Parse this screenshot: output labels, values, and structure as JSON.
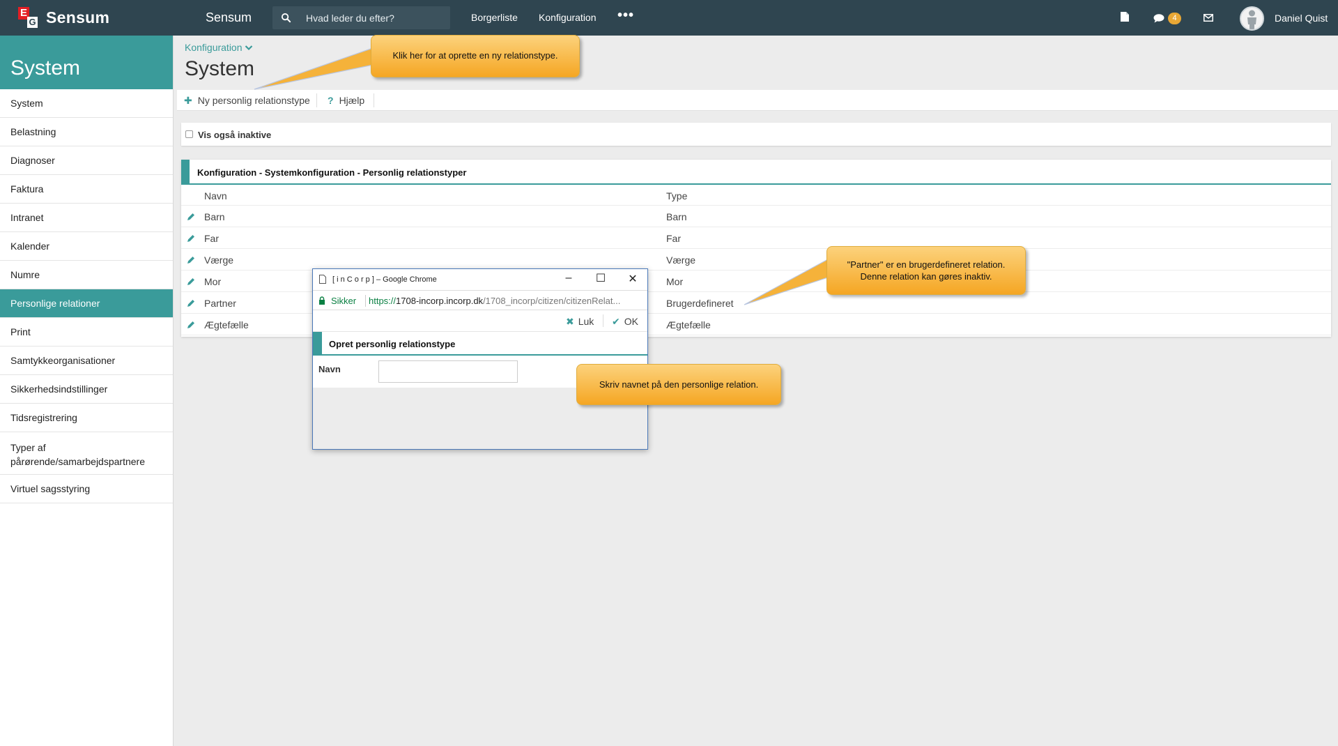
{
  "topbar": {
    "logo_e": "E",
    "logo_g": "G",
    "brand": "Sensum",
    "app_name": "Sensum",
    "search_placeholder": "Hvad leder du efter?",
    "nav": [
      "Borgerliste",
      "Konfiguration"
    ],
    "more": "•••",
    "messages_count": "4",
    "user_name": "Daniel Quist"
  },
  "sidebar": {
    "title": "System",
    "items": [
      {
        "label": "System"
      },
      {
        "label": "Belastning"
      },
      {
        "label": "Diagnoser"
      },
      {
        "label": "Faktura"
      },
      {
        "label": "Intranet"
      },
      {
        "label": "Kalender"
      },
      {
        "label": "Numre"
      },
      {
        "label": "Personlige relationer",
        "active": true
      },
      {
        "label": "Print"
      },
      {
        "label": "Samtykkeorganisationer"
      },
      {
        "label": "Sikkerhedsindstillinger"
      },
      {
        "label": "Tidsregistrering"
      },
      {
        "label": "Typer af pårørende/samarbejdspartnere"
      },
      {
        "label": "Virtuel sagsstyring"
      }
    ]
  },
  "header": {
    "breadcrumb": "Konfiguration",
    "title": "System"
  },
  "toolbar": {
    "new_label": "Ny personlig relationstype",
    "help_label": "Hjælp"
  },
  "filter": {
    "show_inactive_label": "Vis også inaktive",
    "checked": false
  },
  "table": {
    "title": "Konfiguration - Systemkonfiguration - Personlig relationstyper",
    "columns": [
      "Navn",
      "Type"
    ],
    "rows": [
      {
        "navn": "Barn",
        "type": "Barn"
      },
      {
        "navn": "Far",
        "type": "Far"
      },
      {
        "navn": "Værge",
        "type": "Værge"
      },
      {
        "navn": "Mor",
        "type": "Mor"
      },
      {
        "navn": "Partner",
        "type": "Brugerdefineret"
      },
      {
        "navn": "Ægtefælle",
        "type": "Ægtefælle"
      }
    ]
  },
  "popup": {
    "window_title": "[ i n C o r p ] – Google Chrome",
    "secure_label": "Sikker",
    "url_scheme": "https://",
    "url_host": "1708-incorp.incorp.dk",
    "url_path": "/1708_incorp/citizen/citizenRelat...",
    "close_label": "Luk",
    "ok_label": "OK",
    "panel_title": "Opret personlig relationstype",
    "field_label": "Navn",
    "field_value": ""
  },
  "callouts": {
    "new_type": "Klik her for at oprette en ny relationstype.",
    "partner_line1": "\"Partner\" er en brugerdefineret relation.",
    "partner_line2": "Denne relation kan gøres inaktiv.",
    "name_field": "Skriv navnet på den personlige relation."
  },
  "colors": {
    "topbar": "#2f4550",
    "accent": "#3a9b9a",
    "callout": "#f5a623",
    "badge": "#e8a735"
  }
}
